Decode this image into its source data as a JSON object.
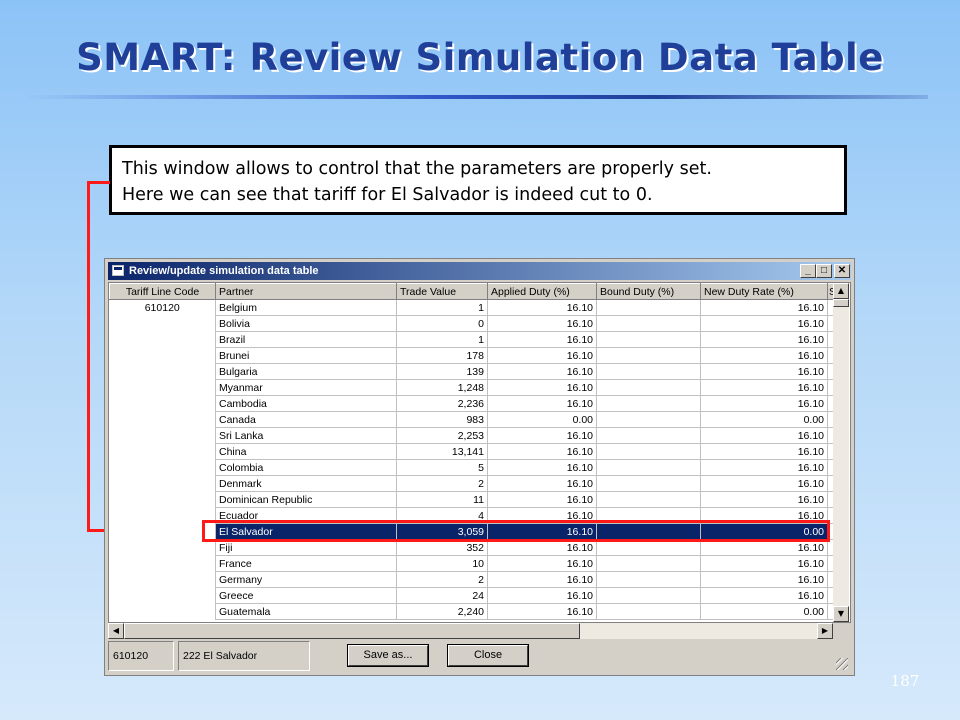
{
  "slide": {
    "title": "SMART: Review Simulation Data Table",
    "callout": [
      "This window allows to control that the parameters are properly set.",
      "Here we can see that tariff for El Salvador is indeed cut to 0."
    ],
    "page_number": "187"
  },
  "window": {
    "title": "Review/update simulation data table",
    "columns": [
      "Tariff Line Code",
      "Partner",
      "Trade Value",
      "Applied Duty (%)",
      "Bound Duty (%)",
      "New Duty Rate (%)",
      "S"
    ],
    "tariff_line_code": "610120",
    "rows": [
      {
        "partner": "Belgium",
        "trade_value": "1",
        "applied": "16.10",
        "bound": "",
        "new_rate": "16.10"
      },
      {
        "partner": "Bolivia",
        "trade_value": "0",
        "applied": "16.10",
        "bound": "",
        "new_rate": "16.10"
      },
      {
        "partner": "Brazil",
        "trade_value": "1",
        "applied": "16.10",
        "bound": "",
        "new_rate": "16.10"
      },
      {
        "partner": "Brunei",
        "trade_value": "178",
        "applied": "16.10",
        "bound": "",
        "new_rate": "16.10"
      },
      {
        "partner": "Bulgaria",
        "trade_value": "139",
        "applied": "16.10",
        "bound": "",
        "new_rate": "16.10"
      },
      {
        "partner": "Myanmar",
        "trade_value": "1,248",
        "applied": "16.10",
        "bound": "",
        "new_rate": "16.10"
      },
      {
        "partner": "Cambodia",
        "trade_value": "2,236",
        "applied": "16.10",
        "bound": "",
        "new_rate": "16.10"
      },
      {
        "partner": "Canada",
        "trade_value": "983",
        "applied": "0.00",
        "bound": "",
        "new_rate": "0.00"
      },
      {
        "partner": "Sri Lanka",
        "trade_value": "2,253",
        "applied": "16.10",
        "bound": "",
        "new_rate": "16.10"
      },
      {
        "partner": "China",
        "trade_value": "13,141",
        "applied": "16.10",
        "bound": "",
        "new_rate": "16.10"
      },
      {
        "partner": "Colombia",
        "trade_value": "5",
        "applied": "16.10",
        "bound": "",
        "new_rate": "16.10"
      },
      {
        "partner": "Denmark",
        "trade_value": "2",
        "applied": "16.10",
        "bound": "",
        "new_rate": "16.10"
      },
      {
        "partner": "Dominican Republic",
        "trade_value": "11",
        "applied": "16.10",
        "bound": "",
        "new_rate": "16.10"
      },
      {
        "partner": "Ecuador",
        "trade_value": "4",
        "applied": "16.10",
        "bound": "",
        "new_rate": "16.10"
      },
      {
        "partner": "El Salvador",
        "trade_value": "3,059",
        "applied": "16.10",
        "bound": "",
        "new_rate": "0.00",
        "selected": true
      },
      {
        "partner": "Fiji",
        "trade_value": "352",
        "applied": "16.10",
        "bound": "",
        "new_rate": "16.10"
      },
      {
        "partner": "France",
        "trade_value": "10",
        "applied": "16.10",
        "bound": "",
        "new_rate": "16.10"
      },
      {
        "partner": "Germany",
        "trade_value": "2",
        "applied": "16.10",
        "bound": "",
        "new_rate": "16.10"
      },
      {
        "partner": "Greece",
        "trade_value": "24",
        "applied": "16.10",
        "bound": "",
        "new_rate": "16.10"
      },
      {
        "partner": "Guatemala",
        "trade_value": "2,240",
        "applied": "16.10",
        "bound": "",
        "new_rate": "0.00"
      }
    ],
    "status_code": "610120",
    "status_partner": "222 El Salvador",
    "buttons": {
      "save_as": "Save as...",
      "close": "Close"
    }
  },
  "colors": {
    "title": "#1f3f99",
    "selection": "#0a246a",
    "highlight": "#ff1a1a"
  }
}
